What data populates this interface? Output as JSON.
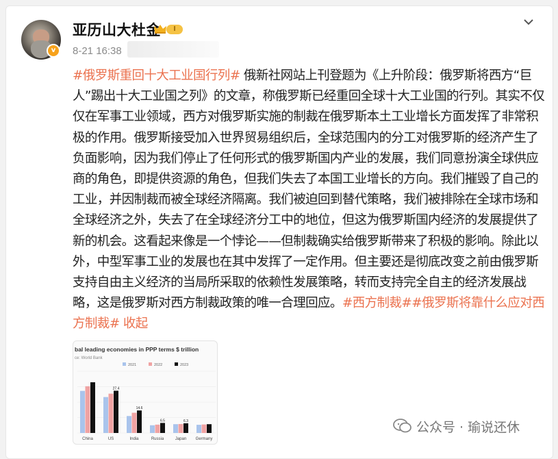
{
  "post": {
    "username": "亚历山大杜金",
    "level_badge": "I",
    "timestamp": "8-21 16:38",
    "hashtag_main": "#俄罗斯重回十大工业国行列#",
    "body_text": " 俄新社网站上刊登题为《上升阶段：俄罗斯将西方“巨人”踢出十大工业国之列》的文章，称俄罗斯已经重回全球十大工业国的行列。其实不仅仅在军事工业领域，西方对俄罗斯实施的制裁在俄罗斯本土工业增长方面发挥了非常积极的作用。俄罗斯接受加入世界贸易组织后，全球范围内的分工对俄罗斯的经济产生了负面影响，因为我们停止了任何形式的俄罗斯国内产业的发展，我们同意扮演全球供应商的角色，即提供资源的角色，但我们失去了本国工业增长的方向。我们摧毁了自己的工业，并因制裁而被全球经济隔离。我们被迫回到替代策略，我们被排除在全球市场和全球经济之外，失去了在全球经济分工中的地位，但这为俄罗斯国内经济的发展提供了新的机会。这看起来像是一个悖论——但制裁确实给俄罗斯带来了积极的影响。除此以外，中型军事工业的发展也在其中发挥了一定作用。但主要还是彻底改变之前由俄罗斯支持自由主义经济的当局所采取的依赖性发展策略，转而支持完全自主的经济发展战略，这是俄罗斯对西方制裁政策的唯一合理回应。",
    "hashtag_2": "#西方制裁#",
    "hashtag_3": "#俄罗斯将靠什么应对西方制裁#",
    "collapse_label": " 收起"
  },
  "thumbnail": {
    "title": "bal leading economies in PPP terms $ trillion",
    "source": "ce: World Bank",
    "legend": [
      "2021",
      "2022",
      "2023"
    ],
    "colors": [
      "#a9c4ec",
      "#f0a3a3",
      "#111111"
    ]
  },
  "chart_data": {
    "type": "bar",
    "title": "bal leading economies in PPP terms $ trillion",
    "categories": [
      "China",
      "US",
      "India",
      "Russia",
      "Japan",
      "Germany"
    ],
    "series": [
      {
        "name": "2021",
        "values": [
          27.3,
          23.3,
          11.0,
          5.0,
          5.7,
          5.3
        ]
      },
      {
        "name": "2022",
        "values": [
          30.3,
          25.5,
          13.1,
          5.4,
          5.8,
          5.5
        ]
      },
      {
        "name": "2023",
        "values": [
          32.9,
          27.4,
          14.6,
          6.5,
          6.3,
          5.7
        ]
      }
    ],
    "data_labels": [
      "27.4",
      "14.6",
      "6.5",
      "6.3"
    ],
    "ylim": [
      0,
      40
    ],
    "grid": true,
    "legend_position": "top"
  },
  "watermark": {
    "text": "公众号 · 瑜说还休"
  }
}
